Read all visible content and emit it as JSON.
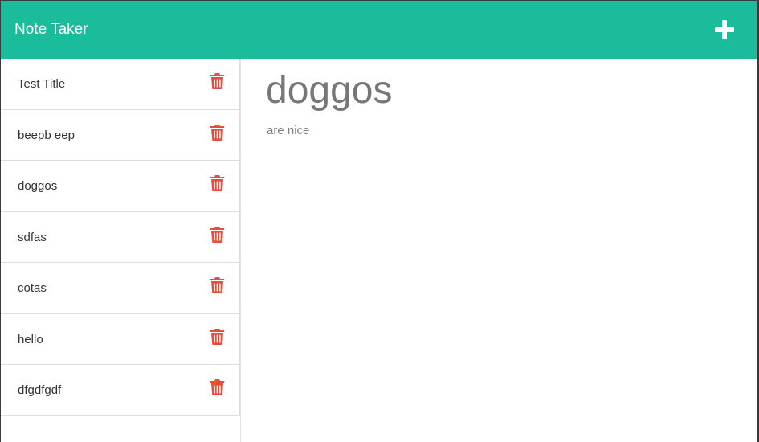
{
  "navbar": {
    "brand": "Note Taker",
    "new_note_icon": "plus-icon"
  },
  "colors": {
    "navbar": "#1abc9c",
    "delete_icon": "#e74c3c",
    "heading_text": "#777777"
  },
  "notes": [
    {
      "title": "Test Title",
      "icon": "trash-icon"
    },
    {
      "title": "beepb eep",
      "icon": "trash-icon"
    },
    {
      "title": "doggos",
      "icon": "trash-icon"
    },
    {
      "title": "sdfas",
      "icon": "trash-icon"
    },
    {
      "title": "cotas",
      "icon": "trash-icon"
    },
    {
      "title": "hello",
      "icon": "trash-icon"
    },
    {
      "title": "dfgdfgdf",
      "icon": "trash-icon"
    }
  ],
  "active_note": {
    "title": "doggos",
    "text": "are nice"
  }
}
